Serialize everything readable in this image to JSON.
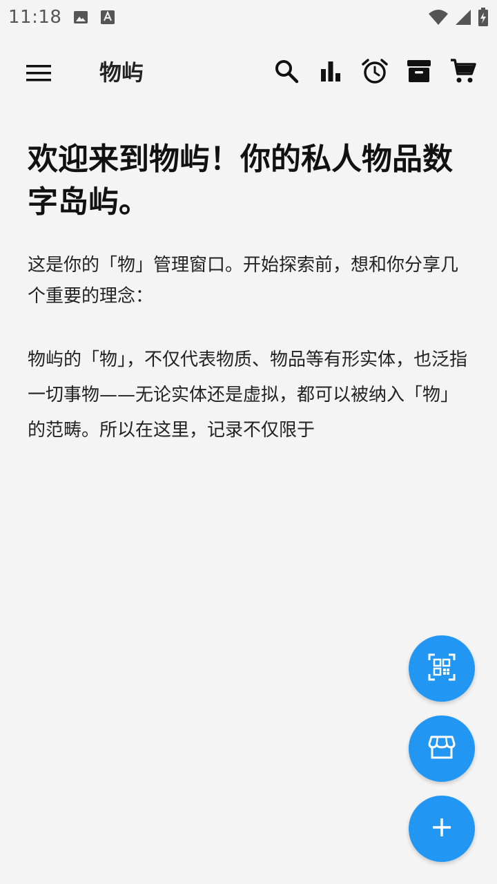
{
  "status_bar": {
    "time": "11:18",
    "icons": [
      "image-icon",
      "text-a-icon",
      "wifi-icon",
      "signal-icon",
      "battery-charging-icon"
    ]
  },
  "app_bar": {
    "title": "物屿",
    "icons": [
      "menu-icon",
      "search-icon",
      "bar-chart-icon",
      "alarm-icon",
      "archive-icon",
      "shopping-cart-icon"
    ]
  },
  "content": {
    "title": "欢迎来到物屿！你的私人物品数字岛屿。",
    "paragraph_1": "这是你的「物」管理窗口。开始探索前，想和你分享几个重要的理念：",
    "paragraph_2": "物屿的「物」，不仅代表物质、物品等有形实体，也泛指一切事物——无论实体还是虚拟，都可以被纳入「物」的范畴。所以在这里，记录不仅限于"
  },
  "fabs": [
    "qr-scan-icon",
    "storefront-icon",
    "add-icon"
  ],
  "colors": {
    "background": "#f4f4f4",
    "fab": "#2196f3",
    "icon": "#111111",
    "status_text": "#555555"
  }
}
